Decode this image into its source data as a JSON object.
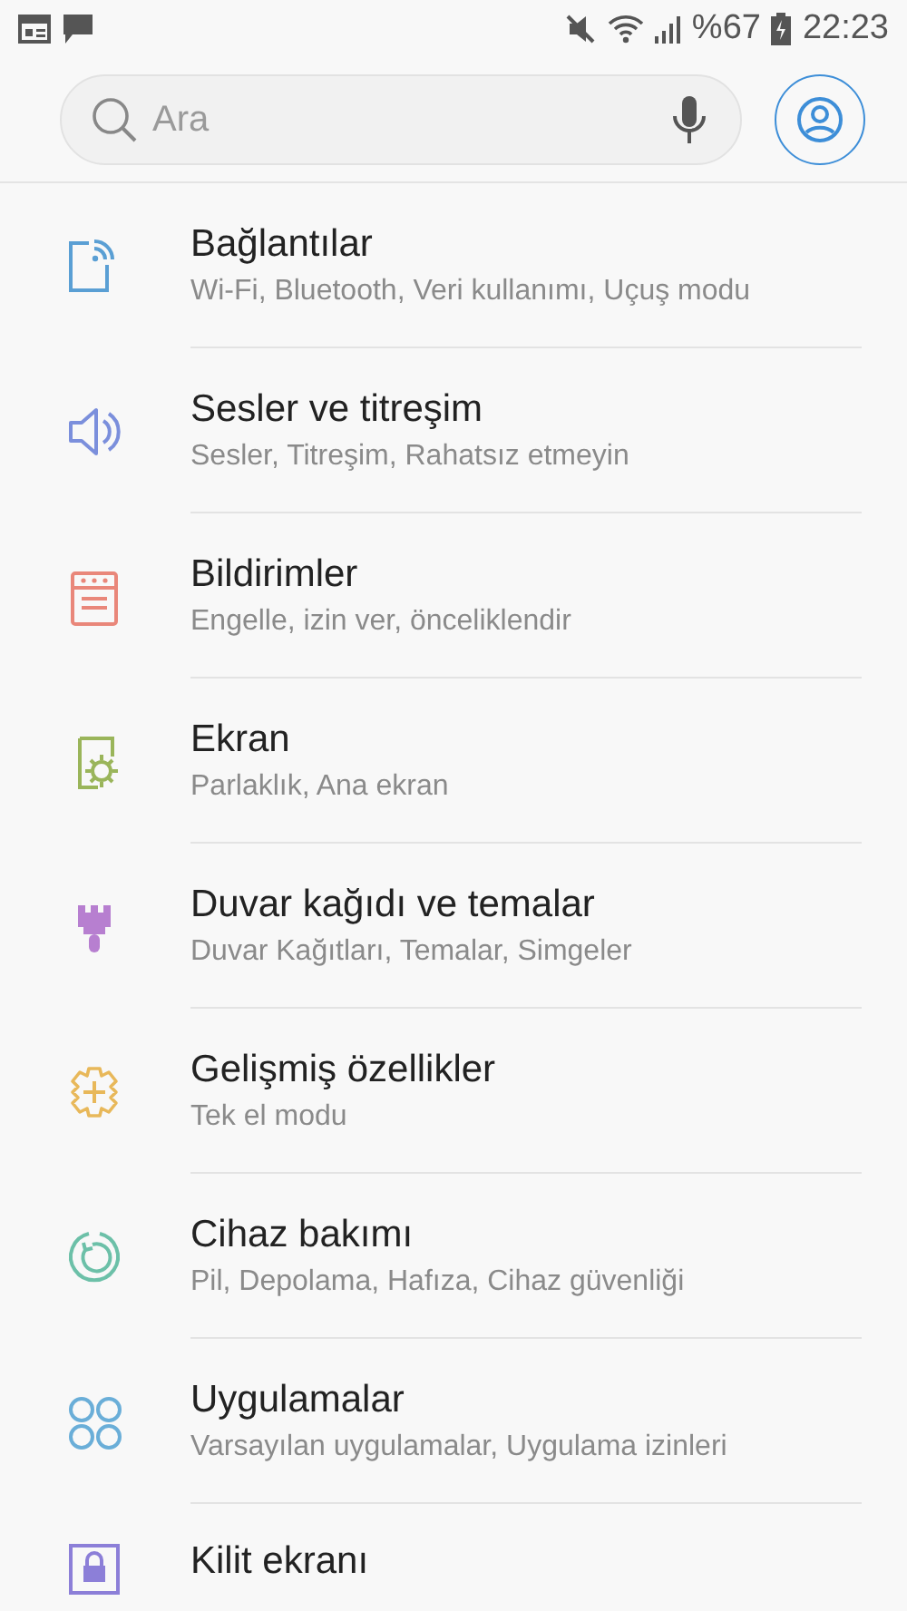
{
  "status_bar": {
    "battery": "%67",
    "time": "22:23"
  },
  "search": {
    "placeholder": "Ara"
  },
  "items": [
    {
      "title": "Bağlantılar",
      "subtitle": "Wi-Fi, Bluetooth, Veri kullanımı, Uçuş modu",
      "color": "#5a9fd4"
    },
    {
      "title": "Sesler ve titreşim",
      "subtitle": "Sesler, Titreşim, Rahatsız etmeyin",
      "color": "#7b8fdc"
    },
    {
      "title": "Bildirimler",
      "subtitle": "Engelle, izin ver, önceliklendir",
      "color": "#e9877a"
    },
    {
      "title": "Ekran",
      "subtitle": "Parlaklık, Ana ekran",
      "color": "#9ab55a"
    },
    {
      "title": "Duvar kağıdı ve temalar",
      "subtitle": "Duvar Kağıtları, Temalar, Simgeler",
      "color": "#b77fd0"
    },
    {
      "title": "Gelişmiş özellikler",
      "subtitle": "Tek el modu",
      "color": "#e8b85a"
    },
    {
      "title": "Cihaz bakımı",
      "subtitle": "Pil, Depolama, Hafıza, Cihaz güvenliği",
      "color": "#6cc0a8"
    },
    {
      "title": "Uygulamalar",
      "subtitle": "Varsayılan uygulamalar, Uygulama izinleri",
      "color": "#6aaed8"
    },
    {
      "title": "Kilit ekranı",
      "color": "#8c7fd8"
    }
  ]
}
